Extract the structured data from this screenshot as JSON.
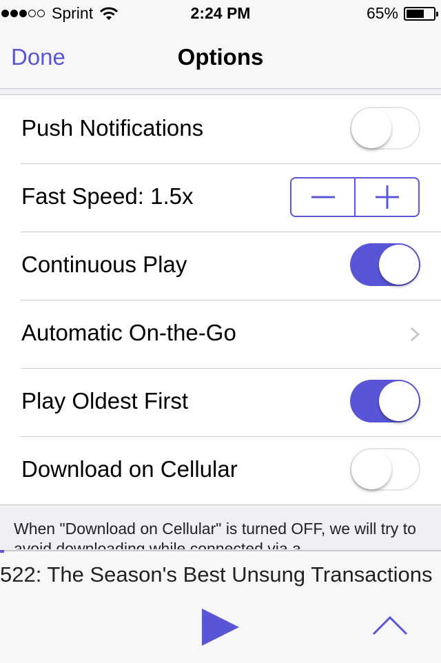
{
  "status_bar": {
    "carrier": "Sprint",
    "signal_bars_filled": 3,
    "signal_bars_total": 5,
    "time": "2:24 PM",
    "battery_percent": "65%",
    "battery_level": 0.65
  },
  "nav": {
    "done_label": "Done",
    "title": "Options"
  },
  "settings": [
    {
      "label": "Push Notifications",
      "control": "toggle",
      "on": false
    },
    {
      "label": "Fast Speed: 1.5x",
      "control": "stepper"
    },
    {
      "label": "Continuous Play",
      "control": "toggle",
      "on": true
    },
    {
      "label": "Automatic On-the-Go",
      "control": "disclosure"
    },
    {
      "label": "Play Oldest First",
      "control": "toggle",
      "on": true
    },
    {
      "label": "Download on Cellular",
      "control": "toggle",
      "on": false
    }
  ],
  "footer_note": "When \"Download on Cellular\" is turned OFF, we will try to avoid downloading while connected via a",
  "player": {
    "episode_title": "522: The Season's Best Unsung Transactions",
    "progress": 0.01
  },
  "colors": {
    "accent": "#5856d6",
    "toggle_off_border": "#e4e4e4",
    "separator": "#c8c7cc",
    "background": "#efeff4"
  }
}
